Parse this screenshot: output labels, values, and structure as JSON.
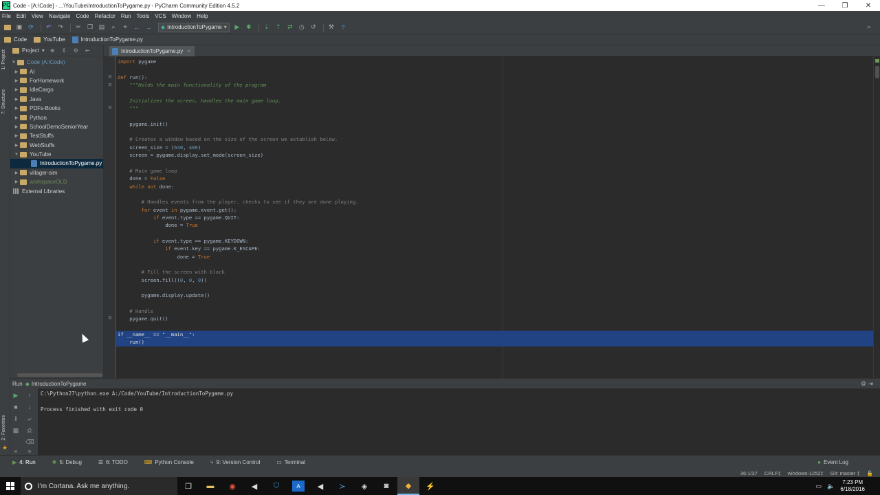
{
  "window": {
    "title": "Code - [A:\\Code] - ...\\YouTube\\IntroductionToPygame.py - PyCharm Community Edition 4.5.2",
    "controls": [
      "—",
      "❐",
      "✕"
    ]
  },
  "menu": [
    "File",
    "Edit",
    "View",
    "Navigate",
    "Code",
    "Refactor",
    "Run",
    "Tools",
    "VCS",
    "Window",
    "Help"
  ],
  "toolbar": {
    "run_config": "IntroductionToPygame",
    "help_label": "?"
  },
  "breadcrumbs": [
    "Code",
    "YouTube",
    "IntroductionToPygame.py"
  ],
  "side_tabs": {
    "project": "1: Project",
    "structure": "7: Structure",
    "favorites": "2: Favorites"
  },
  "project_panel": {
    "header": "Project",
    "root": "Code (A:\\Code)",
    "items": [
      {
        "label": "AI",
        "type": "folder"
      },
      {
        "label": "ForHomework",
        "type": "folder"
      },
      {
        "label": "IdleCargo",
        "type": "folder"
      },
      {
        "label": "Java",
        "type": "folder"
      },
      {
        "label": "PDFs-Books",
        "type": "folder"
      },
      {
        "label": "Python",
        "type": "folder"
      },
      {
        "label": "SchoolDemoSeniorYear",
        "type": "folder"
      },
      {
        "label": "TestStuffs",
        "type": "folder"
      },
      {
        "label": "WebStuffs",
        "type": "folder"
      },
      {
        "label": "YouTube",
        "type": "folder-open"
      },
      {
        "label": "IntroductionToPygame.py",
        "type": "file-selected"
      },
      {
        "label": "villager-sim",
        "type": "folder"
      },
      {
        "label": "workspaceOLD",
        "type": "folder"
      },
      {
        "label": "External Libraries",
        "type": "library"
      }
    ]
  },
  "editor": {
    "tab": "IntroductionToPygame.py",
    "lines": [
      {
        "t": "import pygame",
        "c": "kw"
      },
      {
        "t": "",
        "c": ""
      },
      {
        "t": "def run():",
        "c": "def"
      },
      {
        "t": "    \"\"\"Holds the main functionality of the program",
        "c": "doc"
      },
      {
        "t": "",
        "c": ""
      },
      {
        "t": "    Initializes the screen, handles the main game loop.",
        "c": "doc"
      },
      {
        "t": "    \"\"\"",
        "c": "doc"
      },
      {
        "t": "",
        "c": ""
      },
      {
        "t": "    pygame.init()",
        "c": ""
      },
      {
        "t": "",
        "c": ""
      },
      {
        "t": "    # Creates a window based on the size of the screen we establish below.",
        "c": "cm"
      },
      {
        "t": "    screen_size = (640, 480)",
        "c": ""
      },
      {
        "t": "    screen = pygame.display.set_mode(screen_size)",
        "c": ""
      },
      {
        "t": "",
        "c": ""
      },
      {
        "t": "    # Main game loop",
        "c": "cm"
      },
      {
        "t": "    done = False",
        "c": ""
      },
      {
        "t": "    while not done:",
        "c": ""
      },
      {
        "t": "",
        "c": ""
      },
      {
        "t": "        # Handles events from the player, checks to see if they are done playing.",
        "c": "cm"
      },
      {
        "t": "        for event in pygame.event.get():",
        "c": ""
      },
      {
        "t": "            if event.type == pygame.QUIT:",
        "c": ""
      },
      {
        "t": "                done = True",
        "c": ""
      },
      {
        "t": "",
        "c": ""
      },
      {
        "t": "            if event.type == pygame.KEYDOWN:",
        "c": ""
      },
      {
        "t": "                if event.key == pygame.K_ESCAPE:",
        "c": ""
      },
      {
        "t": "                    done = True",
        "c": ""
      },
      {
        "t": "",
        "c": ""
      },
      {
        "t": "        # Fill the screen with black",
        "c": "cm"
      },
      {
        "t": "        screen.fill((0, 0, 0))",
        "c": ""
      },
      {
        "t": "",
        "c": ""
      },
      {
        "t": "        pygame.display.update()",
        "c": ""
      },
      {
        "t": "",
        "c": ""
      },
      {
        "t": "    # Handle",
        "c": "cm"
      },
      {
        "t": "    pygame.quit()",
        "c": ""
      },
      {
        "t": "",
        "c": ""
      },
      {
        "t": "if __name__ == \"__main__\":",
        "c": "hl"
      },
      {
        "t": "    run()",
        "c": "hl"
      }
    ]
  },
  "run_panel": {
    "header_prefix": "Run",
    "config": "IntroductionToPygame",
    "output": [
      "C:\\Python27\\python.exe A:/Code/YouTube/IntroductionToPygame.py",
      "",
      "Process finished with exit code 0"
    ]
  },
  "tool_tabs": [
    {
      "label": "4: Run",
      "icon": "▶"
    },
    {
      "label": "5: Debug",
      "icon": "✱"
    },
    {
      "label": "6: TODO",
      "icon": "☰"
    },
    {
      "label": "Python Console",
      "icon": "⌨"
    },
    {
      "label": "9: Version Control",
      "icon": "⑂"
    },
    {
      "label": "Terminal",
      "icon": "▭"
    }
  ],
  "event_log": "Event Log",
  "status": {
    "position": "36:1/37",
    "line_sep": "CRLF‡",
    "encoding": "windows-1252‡",
    "git": "Git: master ‡"
  },
  "taskbar": {
    "search_placeholder": "I'm Cortana. Ask me anything.",
    "time": "7:23 PM",
    "date": "6/18/2016"
  },
  "colors": {
    "keyword": "#cc7832",
    "comment": "#808080",
    "docstring": "#629755",
    "number": "#6897bb",
    "selection": "#214283",
    "text": "#a9b7c6"
  }
}
